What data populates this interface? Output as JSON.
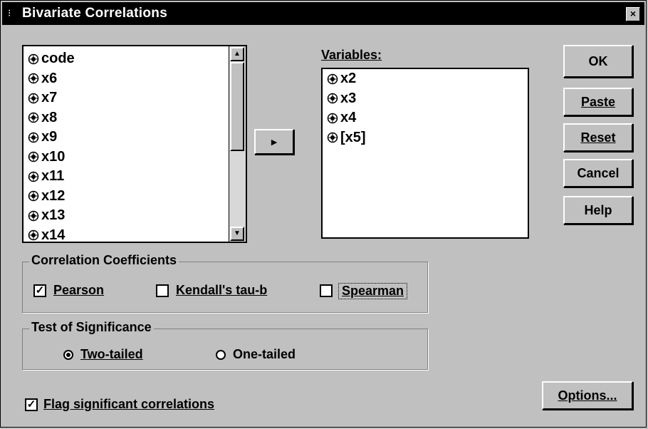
{
  "window": {
    "title": "Bivariate Correlations"
  },
  "source_list": {
    "items": [
      "code",
      "x6",
      "x7",
      "x8",
      "x9",
      "x10",
      "x11",
      "x12",
      "x13",
      "x14"
    ]
  },
  "variables": {
    "label": "Variables:",
    "items": [
      "x2",
      "x3",
      "x4",
      "[x5]"
    ]
  },
  "buttons": {
    "ok": "OK",
    "paste": "Paste",
    "reset": "Reset",
    "cancel": "Cancel",
    "help": "Help",
    "options": "Options...",
    "move": "►"
  },
  "coefficients": {
    "title": "Correlation Coefficients",
    "pearson": {
      "label": "Pearson",
      "checked": true
    },
    "kendall": {
      "label": "Kendall's tau-b",
      "checked": false
    },
    "spearman": {
      "label": "Spearman",
      "checked": false
    }
  },
  "significance": {
    "title": "Test of Significance",
    "two_tailed": {
      "label": "Two-tailed",
      "selected": true
    },
    "one_tailed": {
      "label": "One-tailed",
      "selected": false
    }
  },
  "flag": {
    "label": "Flag significant correlations",
    "checked": true
  }
}
